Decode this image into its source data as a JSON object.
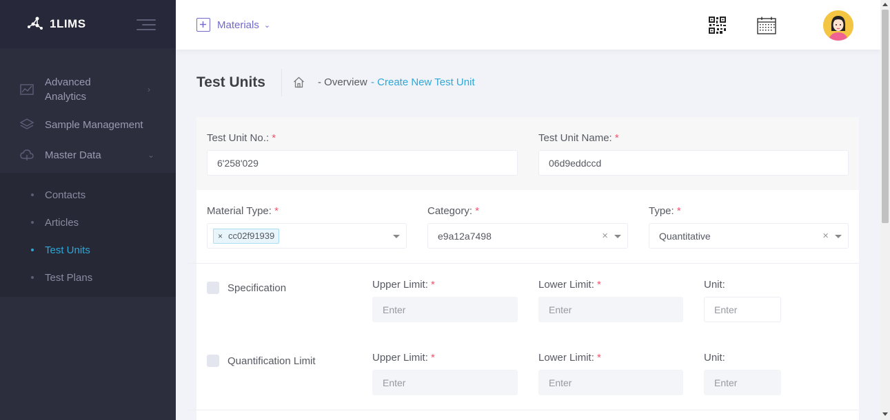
{
  "app": {
    "brand": "1LIMS"
  },
  "header": {
    "module_label": "Materials",
    "qr_icon": "qr-code-icon",
    "calendar_icon": "calendar-icon",
    "avatar_icon": "user-avatar"
  },
  "sidebar": {
    "items": [
      {
        "label": "Advanced Analytics",
        "icon": "analytics-icon"
      },
      {
        "label": "Sample Management",
        "icon": "layers-icon"
      },
      {
        "label": "Master Data",
        "icon": "cloud-icon"
      }
    ],
    "master_data_children": [
      {
        "label": "Contacts",
        "active": false
      },
      {
        "label": "Articles",
        "active": false
      },
      {
        "label": "Test Units",
        "active": true
      },
      {
        "label": "Test Plans",
        "active": false
      }
    ]
  },
  "subheader": {
    "title": "Test Units",
    "crumb_overview": "- Overview",
    "crumb_current": "- Create New Test Unit"
  },
  "form": {
    "test_unit_no": {
      "label": "Test Unit No.:",
      "value": "6'258'029"
    },
    "test_unit_name": {
      "label": "Test Unit Name:",
      "value": "06d9eddccd"
    },
    "material_type": {
      "label": "Material Type:",
      "tag": "cc02f91939"
    },
    "category": {
      "label": "Category:",
      "value": "e9a12a7498"
    },
    "type": {
      "label": "Type:",
      "value": "Quantitative"
    },
    "required_mark": "*",
    "specification": {
      "label": "Specification",
      "checked": false,
      "upper_label": "Upper Limit:",
      "lower_label": "Lower Limit:",
      "unit_label": "Unit:",
      "upper_placeholder": "Enter",
      "lower_placeholder": "Enter",
      "unit_placeholder": "Enter"
    },
    "quantification": {
      "label": "Quantification Limit",
      "checked": false,
      "upper_label": "Upper Limit:",
      "lower_label": "Lower Limit:",
      "unit_label": "Unit:",
      "upper_placeholder": "Enter",
      "lower_placeholder": "Enter",
      "unit_placeholder": "Enter"
    }
  },
  "colors": {
    "sidebar_bg": "#2c2e3e",
    "accent_purple": "#716aca",
    "accent_blue": "#2ea7d6",
    "required_red": "#f4516c"
  }
}
